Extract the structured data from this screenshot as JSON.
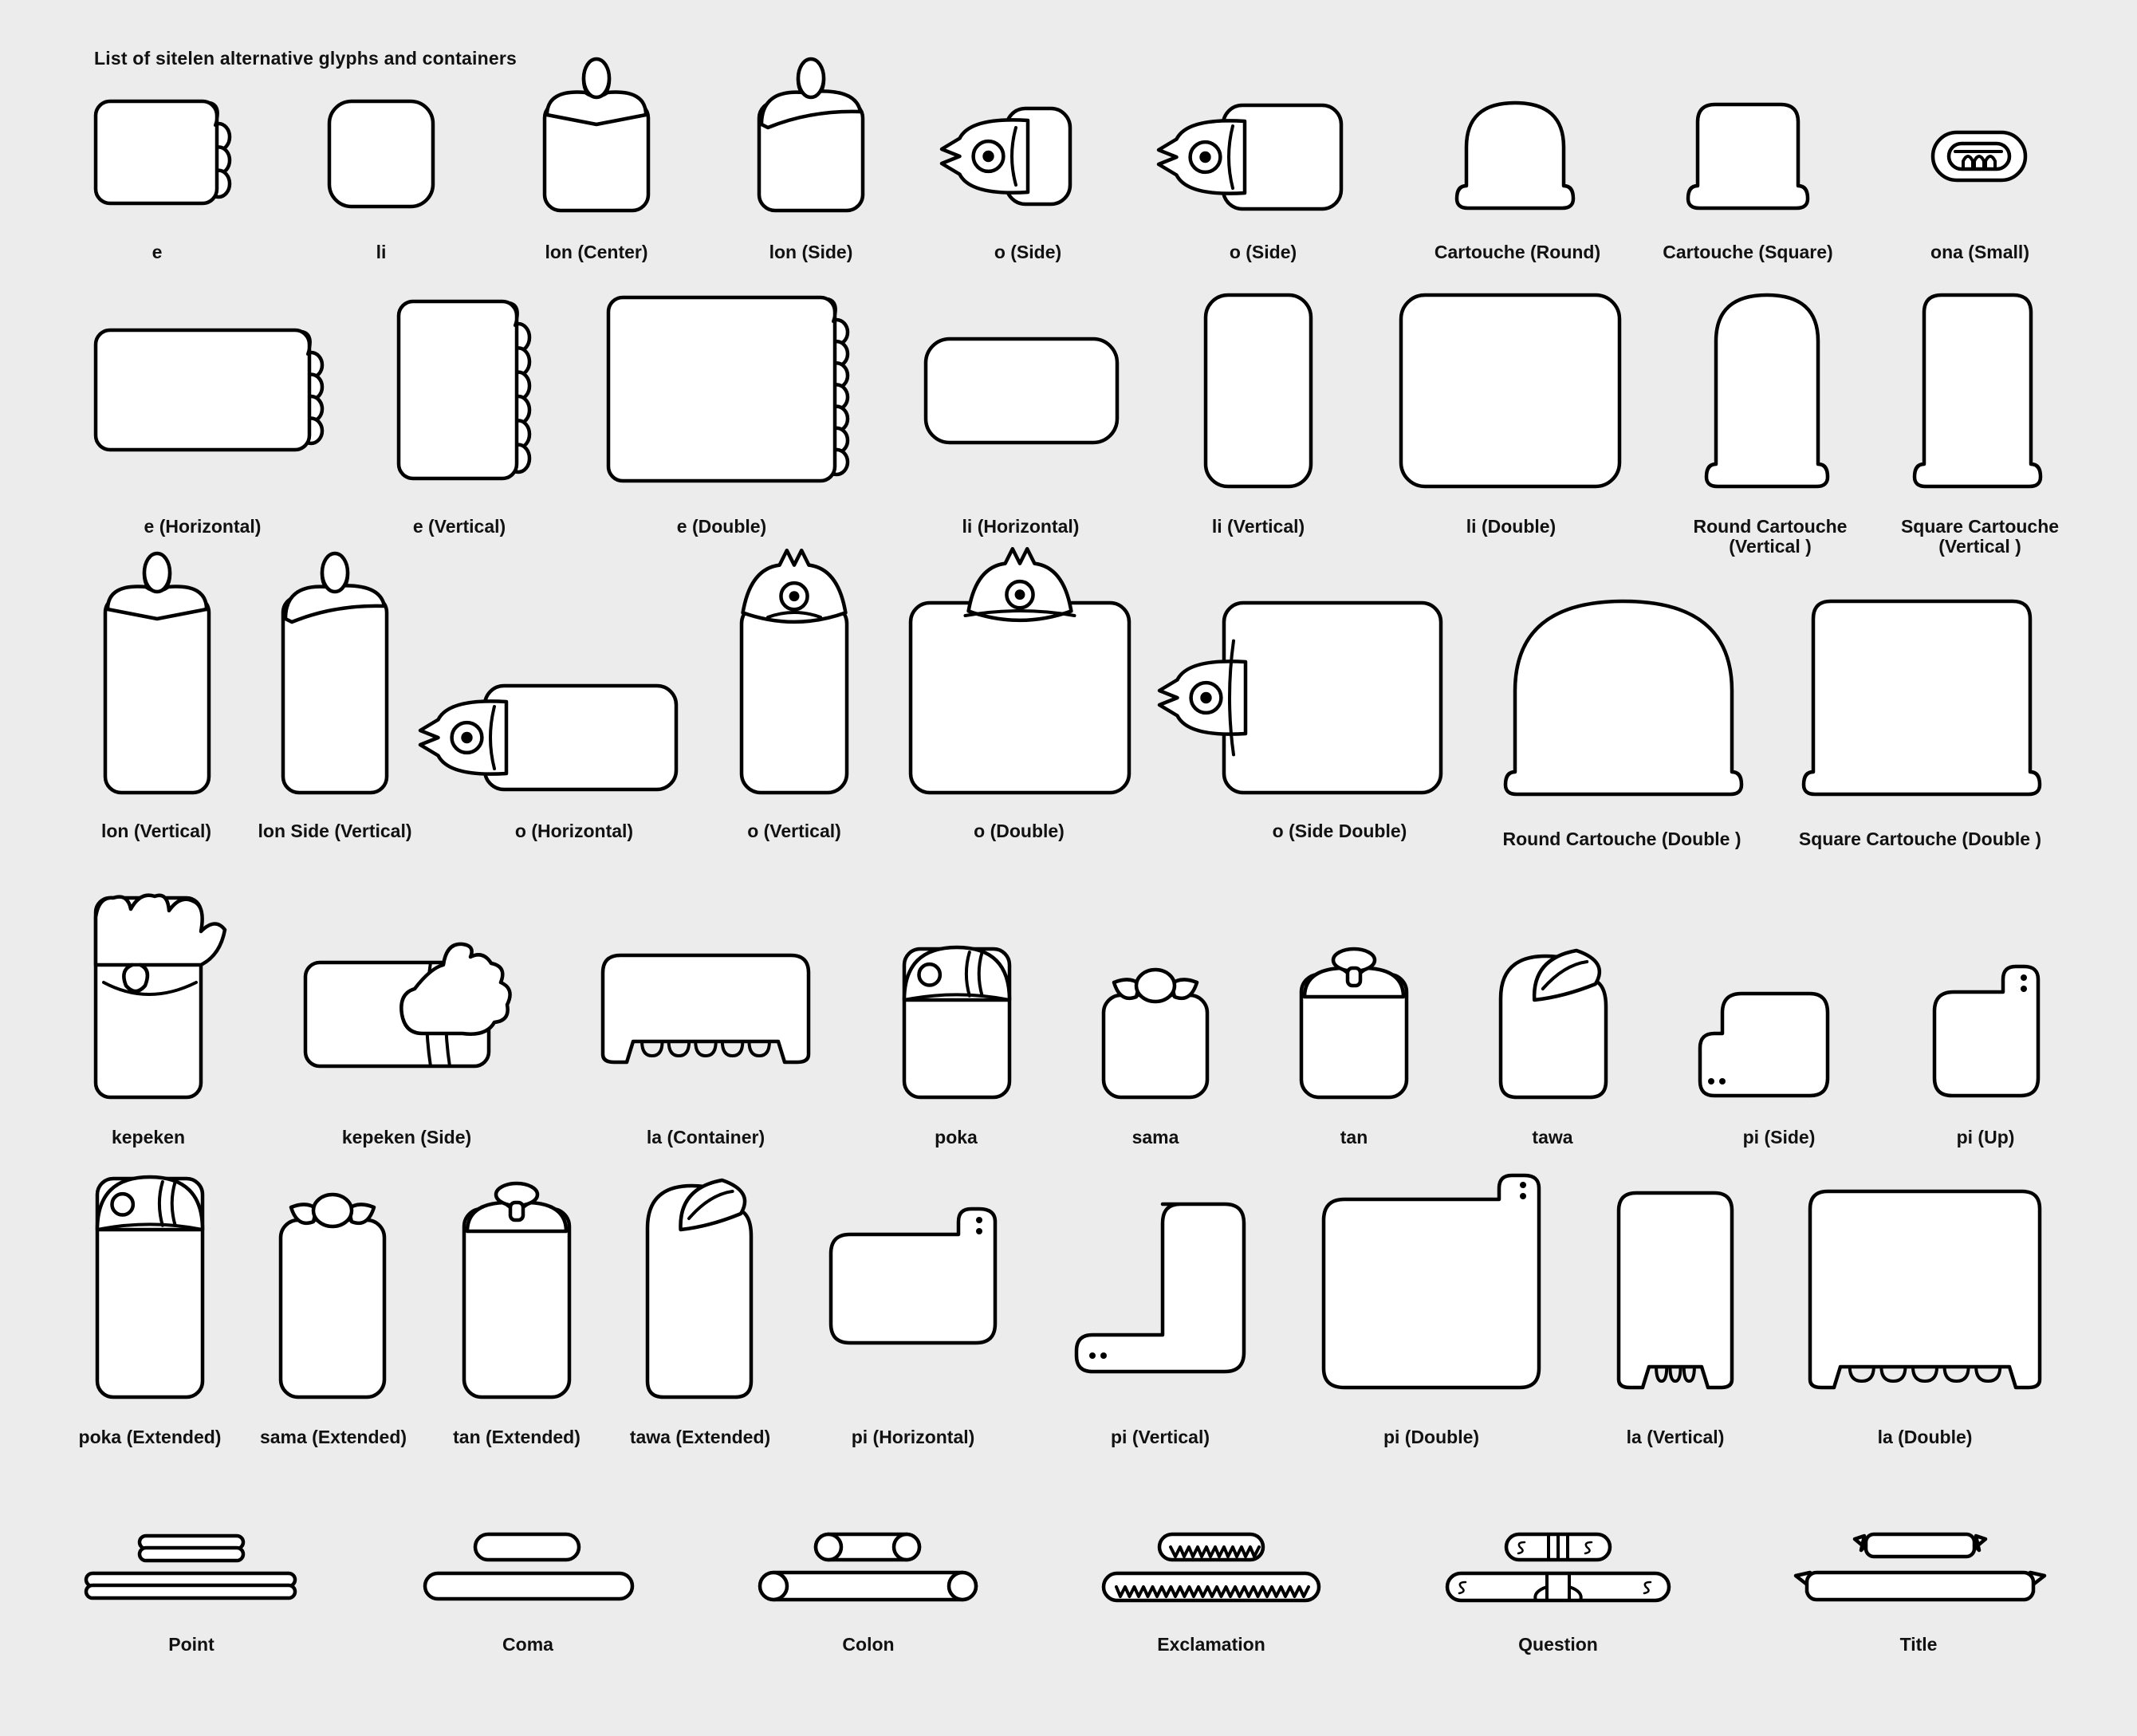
{
  "title": "List of sitelen alternative glyphs and containers",
  "labels": {
    "e": "e",
    "li": "li",
    "lon_center": "lon (Center)",
    "lon_side": "lon (Side)",
    "o_side_1": "o (Side)",
    "o_side_2": "o (Side)",
    "cartouche_round": "Cartouche (Round)",
    "cartouche_square": "Cartouche (Square)",
    "ona_small": "ona (Small)",
    "e_horizontal": "e (Horizontal)",
    "e_vertical": "e (Vertical)",
    "e_double": "e (Double)",
    "li_horizontal": "li (Horizontal)",
    "li_vertical": "li (Vertical)",
    "li_double": "li (Double)",
    "round_cartouche_vertical": "Round Cartouche\n(Vertical )",
    "square_cartouche_vertical": "Square Cartouche\n(Vertical )",
    "lon_vertical": "lon (Vertical)",
    "lon_side_vertical": "lon Side (Vertical)",
    "o_horizontal": "o (Horizontal)",
    "o_vertical": "o (Vertical)",
    "o_double": "o (Double)",
    "o_side_double": "o (Side Double)",
    "round_cartouche_double": "Round Cartouche (Double )",
    "square_cartouche_double": "Square Cartouche (Double )",
    "kepeken": "kepeken",
    "kepeken_side": "kepeken (Side)",
    "la_container": "la (Container)",
    "poka": "poka",
    "sama": "sama",
    "tan": "tan",
    "tawa": "tawa",
    "pi_side": "pi (Side)",
    "pi_up": "pi (Up)",
    "poka_extended": "poka (Extended)",
    "sama_extended": "sama (Extended)",
    "tan_extended": "tan (Extended)",
    "tawa_extended": "tawa (Extended)",
    "pi_horizontal": "pi (Horizontal)",
    "pi_vertical": "pi (Vertical)",
    "pi_double": "pi (Double)",
    "la_vertical": "la (Vertical)",
    "la_double": "la (Double)",
    "point": "Point",
    "coma": "Coma",
    "colon": "Colon",
    "exclamation": "Exclamation",
    "question": "Question",
    "title_glyph": "Title"
  }
}
